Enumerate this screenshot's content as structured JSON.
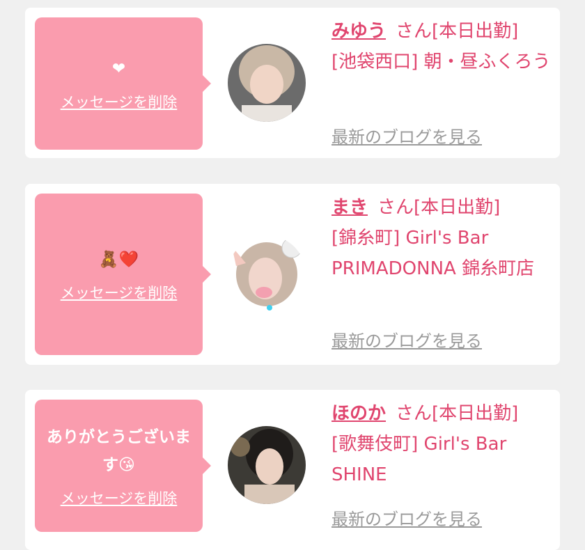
{
  "cards": [
    {
      "message": "❤",
      "delete_label": "メッセージを削除",
      "name": "みゆう",
      "suffix": "さん[本日出勤]",
      "store": "[池袋西口] 朝・昼ふくろう",
      "blog_label": "最新のブログを見る"
    },
    {
      "message": "🧸❤️",
      "delete_label": "メッセージを削除",
      "name": "まき",
      "suffix": "さん[本日出勤]",
      "store": "[錦糸町] Girl's Bar PRIMADONNA 錦糸町店",
      "blog_label": "最新のブログを見る"
    },
    {
      "message": "ありがとうございます😘",
      "delete_label": "メッセージを削除",
      "name": "ほのか",
      "suffix": "さん[本日出勤]",
      "store": "[歌舞伎町] Girl's Bar SHINE",
      "blog_label": "最新のブログを見る"
    }
  ],
  "colors": {
    "accent": "#e0456e",
    "bubble": "#fa9cae",
    "muted": "#9a9a9a"
  }
}
